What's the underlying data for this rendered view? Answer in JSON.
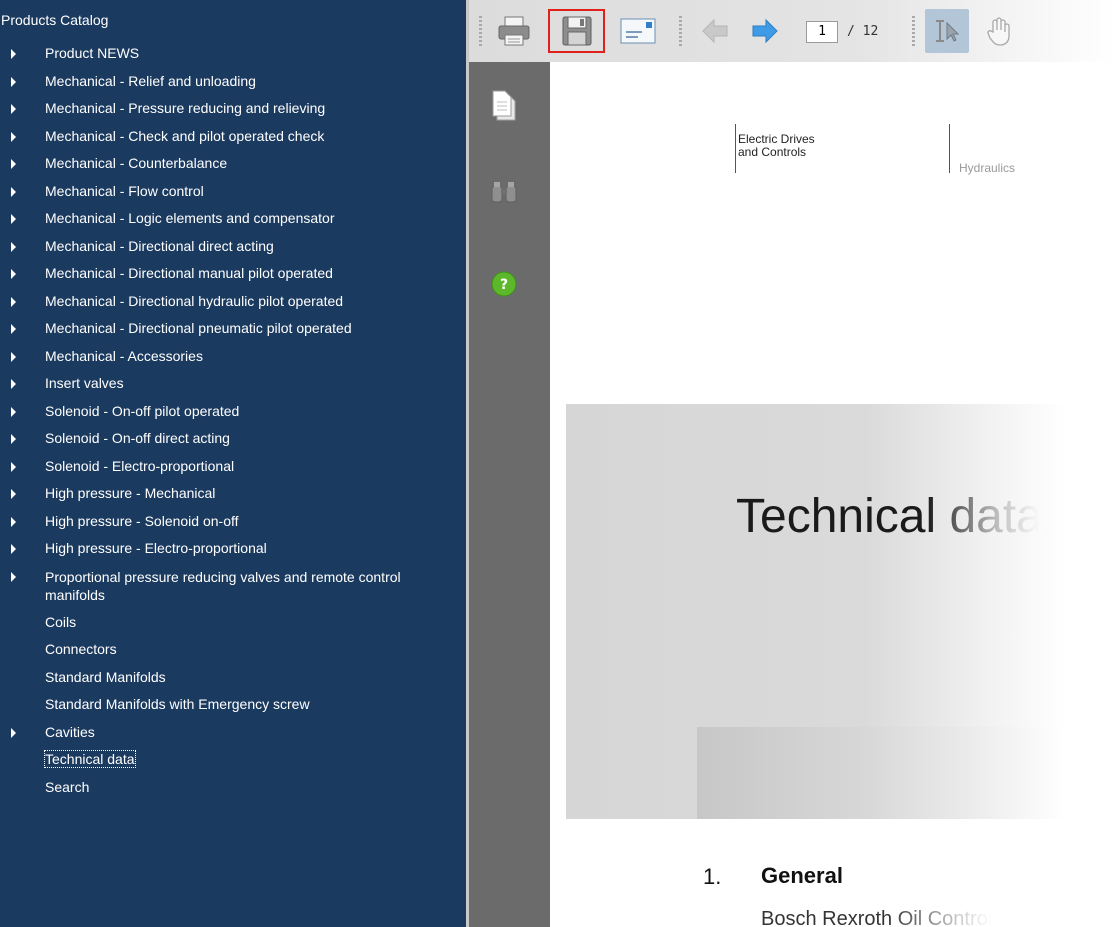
{
  "sidebar": {
    "title": "Products Catalog",
    "items": [
      {
        "label": "Product NEWS",
        "expandable": true
      },
      {
        "label": "Mechanical - Relief and unloading",
        "expandable": true
      },
      {
        "label": "Mechanical - Pressure reducing and relieving",
        "expandable": true
      },
      {
        "label": "Mechanical - Check and pilot operated check",
        "expandable": true
      },
      {
        "label": "Mechanical - Counterbalance",
        "expandable": true
      },
      {
        "label": "Mechanical - Flow control",
        "expandable": true
      },
      {
        "label": "Mechanical - Logic elements and compensator",
        "expandable": true
      },
      {
        "label": "Mechanical - Directional direct acting",
        "expandable": true
      },
      {
        "label": "Mechanical - Directional manual pilot operated",
        "expandable": true
      },
      {
        "label": "Mechanical - Directional hydraulic pilot operated",
        "expandable": true
      },
      {
        "label": "Mechanical - Directional pneumatic pilot operated",
        "expandable": true
      },
      {
        "label": "Mechanical - Accessories",
        "expandable": true
      },
      {
        "label": "Insert valves",
        "expandable": true
      },
      {
        "label": "Solenoid - On-off pilot operated",
        "expandable": true
      },
      {
        "label": "Solenoid - On-off direct acting",
        "expandable": true
      },
      {
        "label": "Solenoid - Electro-proportional",
        "expandable": true
      },
      {
        "label": "High pressure - Mechanical",
        "expandable": true
      },
      {
        "label": "High pressure - Solenoid on-off",
        "expandable": true
      },
      {
        "label": "High pressure - Electro-proportional",
        "expandable": true
      },
      {
        "label": "Proportional pressure reducing valves and remote control manifolds",
        "expandable": true
      },
      {
        "label": "Coils",
        "expandable": false
      },
      {
        "label": "Connectors",
        "expandable": false
      },
      {
        "label": "Standard Manifolds",
        "expandable": false
      },
      {
        "label": "Standard Manifolds with Emergency screw",
        "expandable": false
      },
      {
        "label": "Cavities",
        "expandable": true
      },
      {
        "label": "Technical data",
        "expandable": false,
        "focused": true
      },
      {
        "label": "Search",
        "expandable": false
      }
    ]
  },
  "toolbar": {
    "icons": [
      "print-icon",
      "save-icon",
      "email-icon",
      "back-arrow-icon",
      "forward-arrow-icon",
      "text-select-icon",
      "hand-tool-icon"
    ],
    "page_current": "1",
    "page_total": "/ 12"
  },
  "leftbar": {
    "icons": [
      "pages-icon",
      "find-icon",
      "help-icon"
    ]
  },
  "document": {
    "header_left_line1": "Electric Drives",
    "header_left_line2": "and Controls",
    "header_right": "Hydraulics",
    "big_title": "Technical data",
    "section_number": "1.",
    "section_title": "General",
    "body_text": "Bosch Rexroth Oil Control"
  },
  "colors": {
    "sidebar_bg": "#1b3a5f",
    "highlight_border": "#e0211b",
    "help_green": "#5cb82a"
  }
}
